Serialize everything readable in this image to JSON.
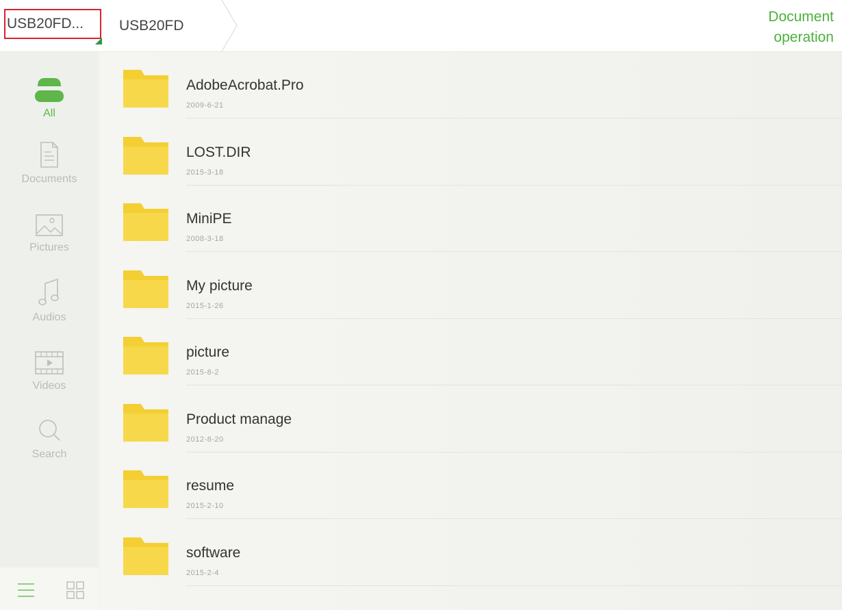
{
  "header": {
    "drive_selector": "USB20FD...",
    "breadcrumb": "USB20FD",
    "document_operation": [
      "Document",
      "operation"
    ]
  },
  "sidebar": {
    "items": [
      {
        "label": "All",
        "icon": "drive-icon",
        "active": true
      },
      {
        "label": "Documents",
        "icon": "document-icon"
      },
      {
        "label": "Pictures",
        "icon": "picture-icon"
      },
      {
        "label": "Audios",
        "icon": "music-note-icon"
      },
      {
        "label": "Videos",
        "icon": "video-icon"
      },
      {
        "label": "Search",
        "icon": "search-icon"
      }
    ],
    "view_modes": [
      "list-view-icon",
      "grid-view-icon"
    ]
  },
  "files": [
    {
      "name": "AdobeAcrobat.Pro",
      "date": "2009-6-21"
    },
    {
      "name": "LOST.DIR",
      "date": "2015-3-18"
    },
    {
      "name": "MiniPE",
      "date": "2008-3-18"
    },
    {
      "name": "My picture",
      "date": "2015-1-26"
    },
    {
      "name": "picture",
      "date": "2015-8-2"
    },
    {
      "name": "Product manage",
      "date": "2012-8-20"
    },
    {
      "name": "resume",
      "date": "2015-2-10"
    },
    {
      "name": "software",
      "date": "2015-2-4"
    }
  ],
  "colors": {
    "accent_green": "#4cb13a",
    "selection_red": "#d6232e",
    "folder_yellow": "#f6d33c"
  }
}
